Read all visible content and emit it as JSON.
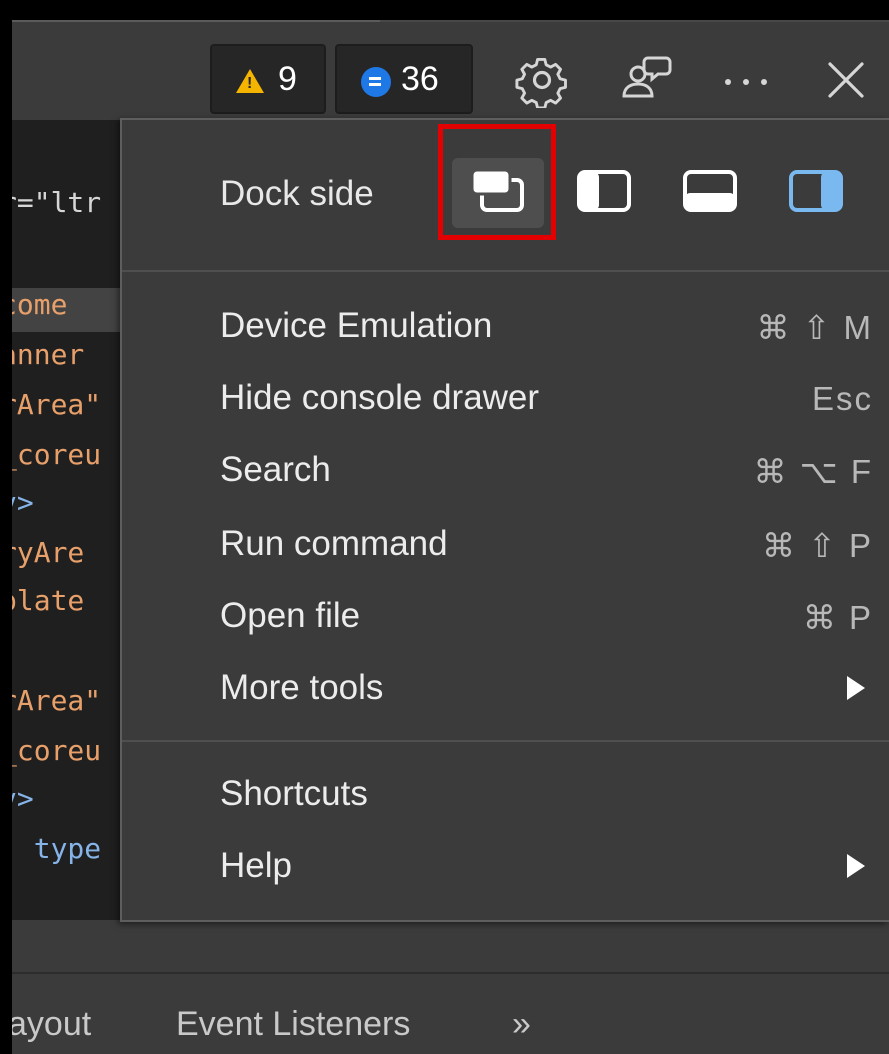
{
  "toolbar": {
    "warnings_count": "9",
    "messages_count": "36",
    "icons": [
      "warning-icon",
      "message-icon",
      "gear-icon",
      "feedback-icon",
      "more-icon",
      "close-icon"
    ]
  },
  "code_fragments": [
    "r=\"ltr",
    "come",
    "anner",
    "rArea\"",
    "_coreu",
    "v>",
    "ryAre",
    "plate",
    "",
    "rArea\"",
    "_coreu",
    "v>",
    "' type"
  ],
  "menu": {
    "dock_side_label": "Dock side",
    "dock_options": [
      "undock-icon",
      "dock-left-icon",
      "dock-bottom-icon",
      "dock-right-icon"
    ],
    "items": [
      {
        "label": "Device Emulation",
        "shortcut": "⌘ ⇧ M"
      },
      {
        "label": "Hide console drawer",
        "shortcut": "Esc"
      },
      {
        "label": "Search",
        "shortcut": "⌘ ⌥ F"
      },
      {
        "label": "Run command",
        "shortcut": "⌘ ⇧ P"
      },
      {
        "label": "Open file",
        "shortcut": "⌘ P"
      },
      {
        "label": "More tools",
        "submenu": true
      }
    ],
    "items2": [
      {
        "label": "Shortcuts"
      },
      {
        "label": "Help",
        "submenu": true
      }
    ]
  },
  "bottom_tabs": [
    "ayout",
    "Event Listeners",
    "»"
  ],
  "colors": {
    "panel": "#3b3b3b",
    "highlight": "#e30000",
    "accent_blue": "#7ab8f0",
    "warning": "#f5b400",
    "message": "#1e78e6"
  }
}
